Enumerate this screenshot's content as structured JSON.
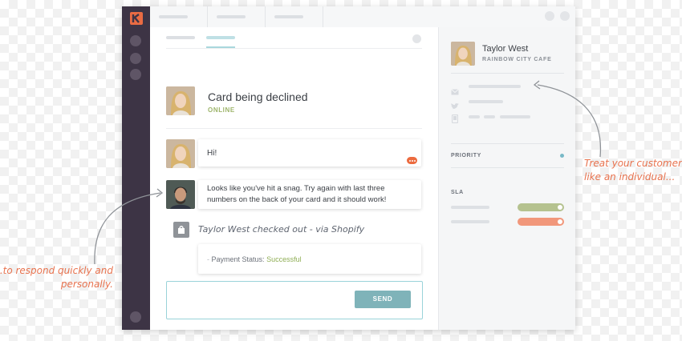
{
  "colors": {
    "rail": "#3d3445",
    "logo": "#e96b43",
    "accent_teal": "#7fb3b9",
    "online_green": "#9db46a",
    "success_green": "#8fae55",
    "sla_green": "#b5c28f",
    "sla_orange": "#f1977b",
    "annotation_orange": "#e8734f"
  },
  "rail": {
    "logo_icon": "kustomer-logo-icon",
    "items": [
      "nav-dot-icon",
      "nav-dot-icon",
      "nav-dot-icon"
    ],
    "profile_icon": "profile-dot-icon"
  },
  "conversation": {
    "title": "Card being declined",
    "status": "ONLINE"
  },
  "messages": [
    {
      "author": "customer",
      "text": "Hi!",
      "typing_icon": "typing-indicator-icon"
    },
    {
      "author": "agent",
      "text_line1": "Looks like you've hit a snag. Try again with last three",
      "text_line2": "numbers on the back of your card and it should work!"
    }
  ],
  "event": {
    "icon": "shopify-bag-icon",
    "text": "Taylor West checked out - via Shopify",
    "payment_label": "Payment Status:",
    "payment_value": "Successful"
  },
  "composer": {
    "send_label": "SEND"
  },
  "customer": {
    "name": "Taylor West",
    "company": "RAINBOW CITY CAFE",
    "contact_icons": [
      "email-icon",
      "twitter-icon",
      "phone-icon"
    ],
    "priority_label": "PRIORITY",
    "sla_label": "SLA"
  },
  "annotations": {
    "right_line1": "Treat your customer",
    "right_line2": "like an individual...",
    "left_line1": "...to respond quickly and",
    "left_line2": "personally."
  }
}
